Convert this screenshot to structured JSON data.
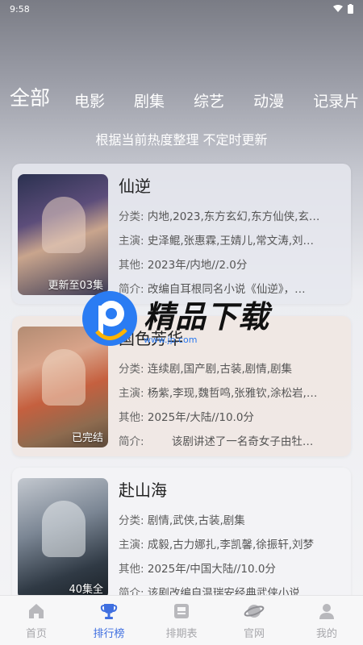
{
  "status": {
    "time": "9:58"
  },
  "tabs": [
    "全部",
    "电影",
    "剧集",
    "综艺",
    "动漫",
    "记录片"
  ],
  "active_tab": 0,
  "subtitle": "根据当前热度整理 不定时更新",
  "labels": {
    "category": "分类:",
    "cast": "主演:",
    "other": "其他:",
    "intro": "简介:"
  },
  "cards": [
    {
      "title": "仙逆",
      "category": "内地,2023,东方玄幻,东方仙侠,玄…",
      "cast": "史泽鲲,张惠霖,王婧儿,常文涛,刘…",
      "other": "2023年/内地//2.0分",
      "intro": "改编自耳根同名小说《仙逆》，…",
      "badge": "更新至03集"
    },
    {
      "title": "国色芳华",
      "category": "连续剧,国产剧,古装,剧情,剧集",
      "cast": "杨紫,李现,魏哲鸣,张雅钦,涂松岩,…",
      "other": "2025年/大陆//10.0分",
      "intro": "       该剧讲述了一名奇女子由牡…",
      "badge": "已完结"
    },
    {
      "title": "赴山海",
      "category": "剧情,武侠,古装,剧集",
      "cast": "成毅,古力娜扎,李凯馨,徐振轩,刘梦",
      "other": "2025年/中国大陆//10.0分",
      "intro": "该剧改编自温瑞安经典武侠小说…",
      "badge": "40集全"
    }
  ],
  "watermark": {
    "text": "精品下载",
    "url": "www.jp.com"
  },
  "nav": [
    {
      "label": "首页",
      "icon": "home-icon"
    },
    {
      "label": "排行榜",
      "icon": "trophy-icon"
    },
    {
      "label": "排期表",
      "icon": "schedule-icon"
    },
    {
      "label": "官网",
      "icon": "planet-icon"
    },
    {
      "label": "我的",
      "icon": "user-icon"
    }
  ],
  "colors": {
    "accent": "#3f6fe0",
    "inactive": "#a7a7ab"
  }
}
